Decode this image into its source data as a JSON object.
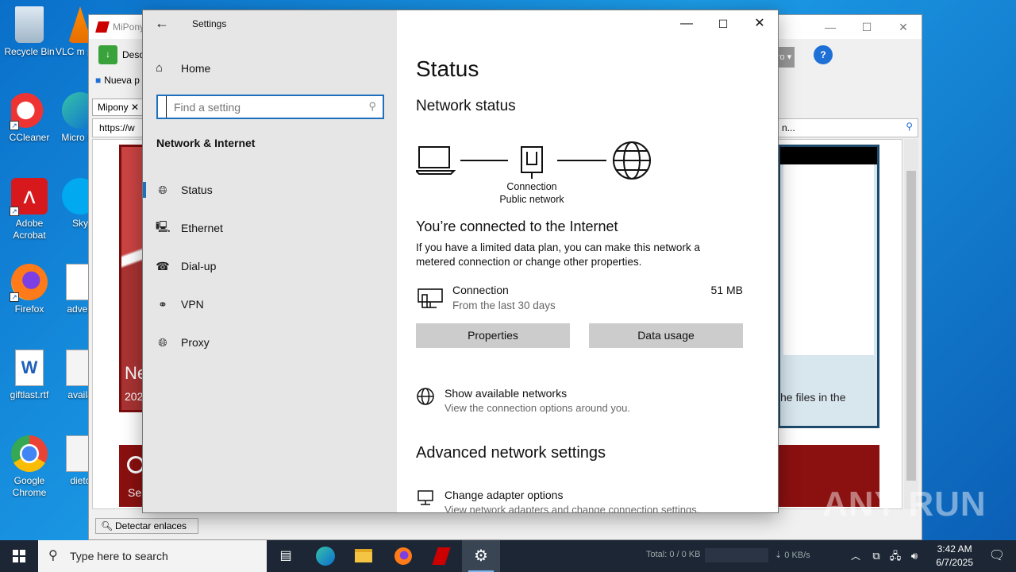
{
  "desktop": {
    "icons": [
      {
        "label": "Recycle Bin",
        "name": "recycle-bin-icon"
      },
      {
        "label": "CCleaner",
        "name": "ccleaner-icon"
      },
      {
        "label": "Adobe Acrobat",
        "name": "adobe-acrobat-icon"
      },
      {
        "label": "Firefox",
        "name": "firefox-icon"
      },
      {
        "label": "giftlast.rtf",
        "name": "word-doc-icon"
      },
      {
        "label": "Google Chrome",
        "name": "chrome-icon"
      },
      {
        "label": "VLC m play",
        "name": "vlc-icon"
      },
      {
        "label": "Micro Ed",
        "name": "edge-icon"
      },
      {
        "label": "Sky",
        "name": "skype-icon"
      },
      {
        "label": "advert",
        "name": "word-doc-icon"
      },
      {
        "label": "availa",
        "name": "image-file-icon"
      },
      {
        "label": "dietc",
        "name": "image-file-icon"
      }
    ],
    "watermark": "ANY RUN"
  },
  "mipony": {
    "title": "MiPony",
    "toolbar_label": "Desc",
    "new_label": "Nueva p",
    "tab_label": "Mipony",
    "url": "https://w",
    "url_right": "n...",
    "dropdown": "ro",
    "panel_text_1": "Ne",
    "panel_text_2": "202",
    "button_text": "Se",
    "ad_text": "he files in the",
    "detect_button": "Detectar enlaces",
    "status_total": "Total: 0 / 0 KB",
    "status_speed": "0 KB/s"
  },
  "settings": {
    "window_title": "Settings",
    "home_label": "Home",
    "search_placeholder": "Find a setting",
    "section_title": "Network & Internet",
    "nav_items": [
      {
        "label": "Status",
        "icon": "globe-icon",
        "active": true
      },
      {
        "label": "Ethernet",
        "icon": "ethernet-icon",
        "active": false
      },
      {
        "label": "Dial-up",
        "icon": "dialup-icon",
        "active": false
      },
      {
        "label": "VPN",
        "icon": "vpn-icon",
        "active": false
      },
      {
        "label": "Proxy",
        "icon": "globe-icon",
        "active": false
      }
    ],
    "page_title": "Status",
    "network_status_heading": "Network status",
    "diagram_label_1": "Connection",
    "diagram_label_2": "Public network",
    "connected_heading": "You’re connected to the Internet",
    "connected_desc": "If you have a limited data plan, you can make this network a metered connection or change other properties.",
    "connection_name": "Connection",
    "connection_period": "From the last 30 days",
    "connection_usage": "51 MB",
    "properties_button": "Properties",
    "data_usage_button": "Data usage",
    "show_networks_title": "Show available networks",
    "show_networks_desc": "View the connection options around you.",
    "advanced_heading": "Advanced network settings",
    "adapter_title": "Change adapter options",
    "adapter_desc": "View network adapters and change connection settings."
  },
  "taskbar": {
    "search_placeholder": "Type here to search",
    "time": "3:42 AM",
    "date": "6/7/2025"
  },
  "colors": {
    "accent": "#1f6fbf",
    "nav_bg": "#e6e6e6",
    "button_bg": "#cccccc",
    "taskbar": "#1c2634"
  }
}
